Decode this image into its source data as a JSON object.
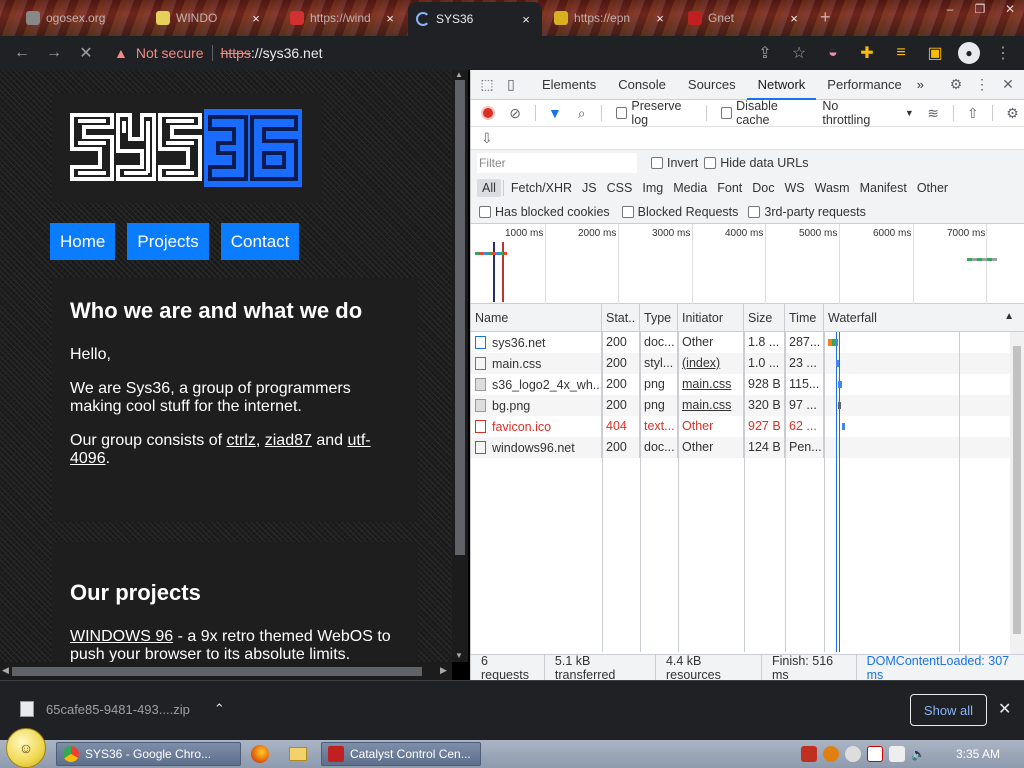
{
  "browser": {
    "tabs": [
      {
        "title": "ogosex.org",
        "active": false
      },
      {
        "title": "WINDO",
        "active": false
      },
      {
        "title": "https://wind",
        "active": false
      },
      {
        "title": "SYS36",
        "active": true
      },
      {
        "title": "https://epn",
        "active": false
      },
      {
        "title": "Gnet",
        "active": false
      }
    ],
    "new_tab_label": "+",
    "address": {
      "security_label": "Not secure",
      "scheme": "https",
      "rest": "://sys36.net"
    }
  },
  "page": {
    "nav": [
      "Home",
      "Projects",
      "Contact"
    ],
    "card1": {
      "heading": "Who we are and what we do",
      "p1": "Hello,",
      "p2": "We are Sys36, a group of programmers making cool stuff for the internet.",
      "p3_prefix": "Our group consists of ",
      "member1": "ctrlz",
      "sep1": ", ",
      "member2": "ziad87",
      "sep2": " and ",
      "member3": "utf-4096",
      "p3_suffix": "."
    },
    "card2": {
      "heading": "Our projects",
      "project_link": "WINDOWS 96",
      "project_desc": " - a 9x retro themed WebOS to push your browser to its absolute limits."
    }
  },
  "devtools": {
    "tabs": [
      "Elements",
      "Console",
      "Sources",
      "Network",
      "Performance"
    ],
    "active_tab": "Network",
    "more_tabs": "»",
    "toolbar": {
      "preserve_log": "Preserve log",
      "disable_cache": "Disable cache",
      "throttling": "No throttling"
    },
    "filter": {
      "placeholder": "Filter",
      "invert": "Invert",
      "hide_data_urls": "Hide data URLs"
    },
    "types": [
      "All",
      "Fetch/XHR",
      "JS",
      "CSS",
      "Img",
      "Media",
      "Font",
      "Doc",
      "WS",
      "Wasm",
      "Manifest",
      "Other"
    ],
    "blocked": {
      "has_blocked_cookies": "Has blocked cookies",
      "blocked_requests": "Blocked Requests",
      "third_party": "3rd-party requests"
    },
    "overview_ticks": [
      "1000 ms",
      "2000 ms",
      "3000 ms",
      "4000 ms",
      "5000 ms",
      "6000 ms",
      "7000 ms"
    ],
    "columns": [
      "Name",
      "Stat..",
      "Type",
      "Initiator",
      "Size",
      "Time",
      "Waterfall"
    ],
    "requests": [
      {
        "name": "sys36.net",
        "status": "200",
        "type": "doc...",
        "initiator": "Other",
        "size": "1.8 ...",
        "time": "287...",
        "kind": "doc",
        "error": false
      },
      {
        "name": "main.css",
        "status": "200",
        "type": "styl...",
        "initiator": "(index)",
        "size": "1.0 ...",
        "time": "23 ...",
        "kind": "css",
        "error": false
      },
      {
        "name": "s36_logo2_4x_wh...",
        "status": "200",
        "type": "png",
        "initiator": "main.css",
        "size": "928 B",
        "time": "115...",
        "kind": "img",
        "error": false
      },
      {
        "name": "bg.png",
        "status": "200",
        "type": "png",
        "initiator": "main.css",
        "size": "320 B",
        "time": "97 ...",
        "kind": "img",
        "error": false
      },
      {
        "name": "favicon.ico",
        "status": "404",
        "type": "text...",
        "initiator": "Other",
        "size": "927 B",
        "time": "62 ...",
        "kind": "err",
        "error": true
      },
      {
        "name": "windows96.net",
        "status": "200",
        "type": "doc...",
        "initiator": "Other",
        "size": "124 B",
        "time": "Pen...",
        "kind": "doc",
        "error": false
      }
    ],
    "status": {
      "requests": "6 requests",
      "transferred": "5.1 kB transferred",
      "resources": "4.4 kB resources",
      "finish": "Finish: 516 ms",
      "dcl": "DOMContentLoaded: 307 ms"
    }
  },
  "downloads": {
    "file": "65cafe85-9481-493....zip",
    "show_all": "Show all"
  },
  "taskbar": {
    "tasks": [
      {
        "title": "SYS36 - Google Chro...",
        "icon": "chrome-icon"
      },
      {
        "title": "Catalyst Control Cen...",
        "icon": "catalyst-icon"
      }
    ],
    "clock": "3:35 AM"
  },
  "colors": {
    "nav_button": "#0a7cff",
    "logo_white": "#ffffff",
    "logo_blue": "#1a6cff",
    "link_error": "#d93025",
    "devtools_accent": "#1a73e8"
  }
}
